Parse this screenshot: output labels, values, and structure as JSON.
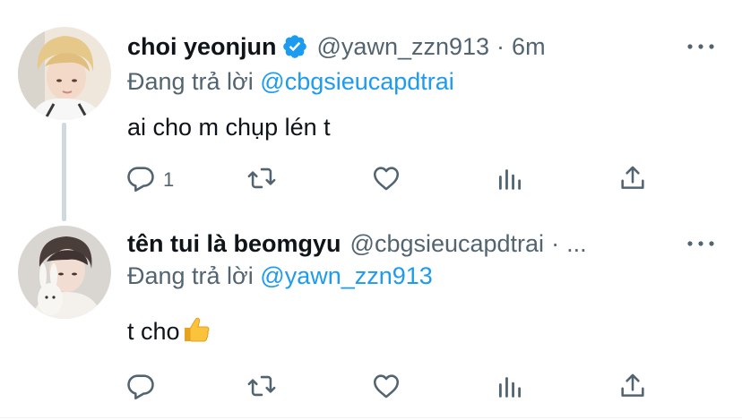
{
  "tweets": [
    {
      "display_name": "choi yeonjun",
      "verified": true,
      "handle": "@yawn_zzn913",
      "separator": "·",
      "time": "6m",
      "reply_prefix": "Đang trả lời",
      "reply_to": "@cbgsieucapdtrai",
      "text": "ai cho m chụp lén t",
      "reply_count": "1"
    },
    {
      "display_name": "tên tui là beomgyu",
      "verified": false,
      "handle": "@cbgsieucapdtrai",
      "separator": "·",
      "time": "...",
      "reply_prefix": "Đang trả lời",
      "reply_to": "@yawn_zzn913",
      "text": "t cho",
      "text_emoji": "thumbs-up-emoji",
      "reply_count": ""
    }
  ],
  "colors": {
    "text": "#0f1419",
    "secondary": "#536471",
    "accent": "#1d9bf0",
    "thread_line": "#cfd9de"
  },
  "icons": [
    "verified-badge-icon",
    "more-icon",
    "reply-icon",
    "retweet-icon",
    "like-icon",
    "stats-icon",
    "share-icon"
  ]
}
